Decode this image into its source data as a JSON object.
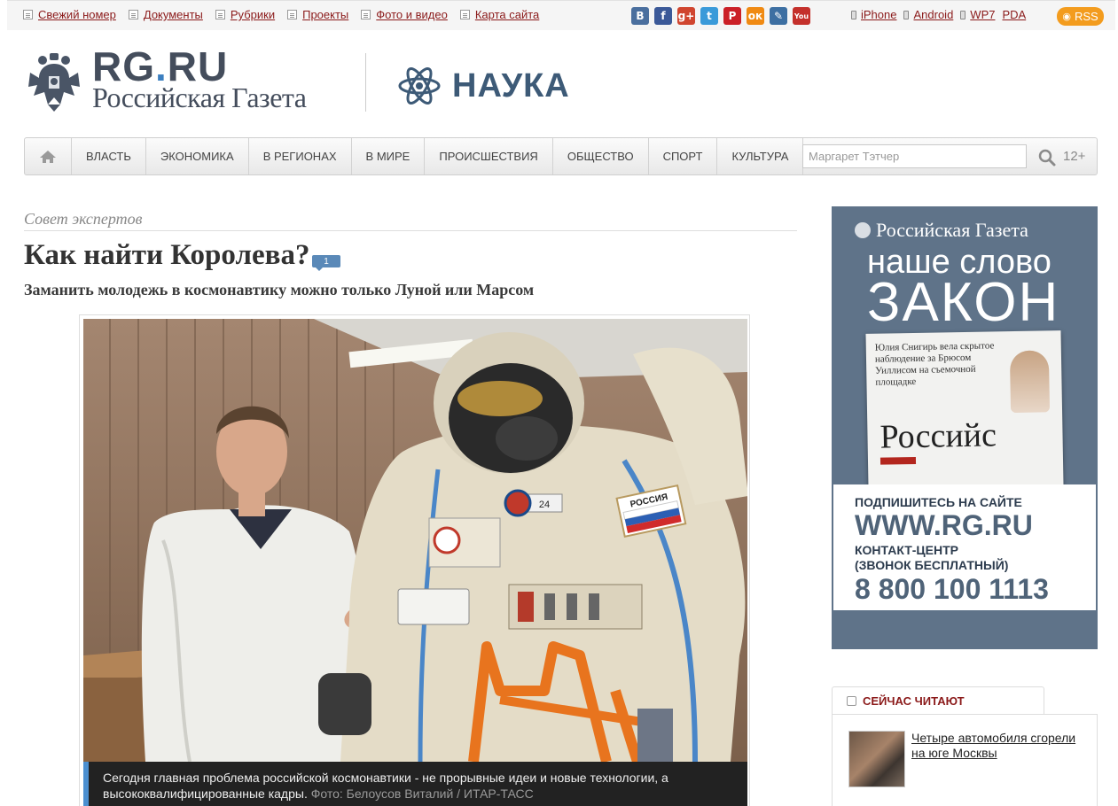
{
  "topbar": {
    "links": [
      "Свежий номер",
      "Документы",
      "Рубрики",
      "Проекты",
      "Фото и видео",
      "Карта сайта"
    ],
    "social": [
      {
        "name": "vkontakte-icon",
        "glyph": "В",
        "color": "#4a6f9e"
      },
      {
        "name": "facebook-icon",
        "glyph": "f",
        "color": "#3b5998"
      },
      {
        "name": "google-plus-icon",
        "glyph": "g+",
        "color": "#d0452f"
      },
      {
        "name": "twitter-icon",
        "glyph": "t",
        "color": "#3a9ad9"
      },
      {
        "name": "pinterest-icon",
        "glyph": "P",
        "color": "#cb2027"
      },
      {
        "name": "odnoklassniki-icon",
        "glyph": "ок",
        "color": "#f08a13"
      },
      {
        "name": "livejournal-icon",
        "glyph": "✎",
        "color": "#3d6fa2"
      },
      {
        "name": "youtube-icon",
        "glyph": "You",
        "color": "#c4302b"
      }
    ],
    "mobile": [
      "iPhone",
      "Android",
      "WP7",
      "PDA"
    ],
    "rss_label": "RSS"
  },
  "masthead": {
    "logo_main": "RG",
    "logo_dot": ".",
    "logo_tld": "RU",
    "logo_sub": "Российская Газета",
    "section": "НАУКА"
  },
  "nav": {
    "items": [
      "ВЛАСТЬ",
      "ЭКОНОМИКА",
      "В РЕГИОНАХ",
      "В МИРЕ",
      "ПРОИСШЕСТВИЯ",
      "ОБЩЕСТВО",
      "СПОРТ",
      "КУЛЬТУРА"
    ],
    "search_placeholder": "Маргарет Тэтчер",
    "age_rating": "12+"
  },
  "article": {
    "rubric": "Совет экспертов",
    "headline": "Как найти Королева?",
    "comments_count": "1",
    "subtitle": "Заманить молодежь в космонавтику можно только Луной или Марсом",
    "caption": "Сегодня главная проблема российской космонавтики - не прорывные идеи и новые технологии, а высококвалифицированные кадры.",
    "credit": "Фото: Белоусов Виталий / ИТАР-ТАСС",
    "suit_patch": "РОССИЯ",
    "suit_number": "24"
  },
  "ad": {
    "brand": "Российская Газета",
    "line1": "наше слово",
    "line2": "ЗАКОН",
    "paper_text": "Юлия Снигирь вела скрытое наблюдение за Брюсом Уиллисом на съемочной площадке",
    "paper_mast": "Российс",
    "w1": "ПОДПИШИТЕСЬ НА САЙТЕ",
    "w2": "WWW.RG.RU",
    "w3": "КОНТАКТ-ЦЕНТР",
    "w4": "(ЗВОНОК БЕСПЛАТНЫЙ)",
    "w5": "8 800 100 1113"
  },
  "reading": {
    "tab_label": "СЕЙЧАС ЧИТАЮТ",
    "items": [
      {
        "title": "Четыре автомобиля сгорели на юге Москвы"
      }
    ]
  }
}
